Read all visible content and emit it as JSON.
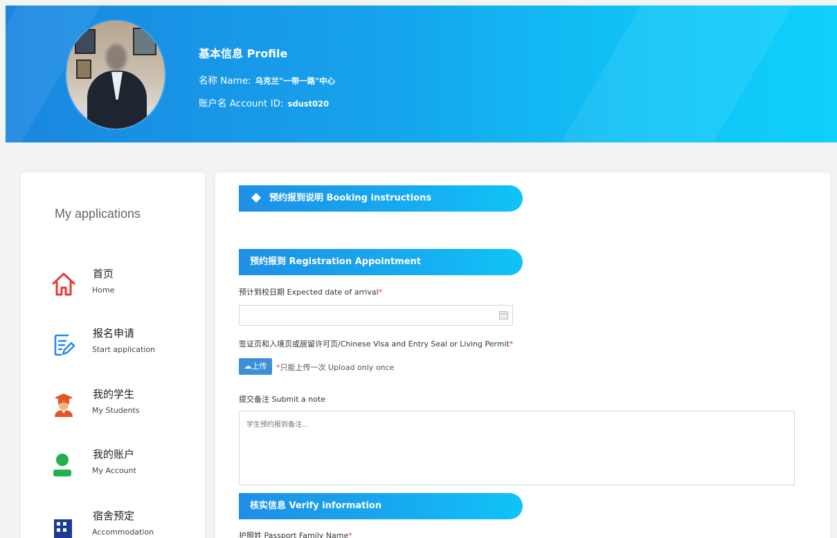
{
  "profile": {
    "title": "基本信息 Profile",
    "name_label": "名称 Name:",
    "name_value": "乌克兰\"一带一路\"中心",
    "account_label": "账户名 Account ID:",
    "account_value": "sdust020"
  },
  "sidebar": {
    "title": "My applications",
    "items": [
      {
        "cn": "首页",
        "en": "Home",
        "icon": "home-icon"
      },
      {
        "cn": "报名申请",
        "en": "Start application",
        "icon": "edit-document-icon"
      },
      {
        "cn": "我的学生",
        "en": "My Students",
        "icon": "graduate-student-icon"
      },
      {
        "cn": "我的账户",
        "en": "My Account",
        "icon": "user-account-icon"
      },
      {
        "cn": "宿舍预定",
        "en": "Accommodation",
        "icon": "building-icon"
      }
    ]
  },
  "main": {
    "booking_instructions": "预约报到说明 Booking instructions",
    "registration_title": "预约报到 Registration Appointment",
    "arrival_label": "预计到校日期 Expected date of arrival",
    "arrival_value": "",
    "visa_label": "签证页和入境页或居留许可页/Chinese Visa and Entry Seal or Living Permit",
    "upload_button": "上传",
    "upload_note": "只能上传一次 Upload only once",
    "note_label": "提交备注 Submit a note",
    "note_placeholder": "学生预约报到备注...",
    "verify_title": "核实信息 Verify information",
    "family_name_label": "护照姓 Passport Family Name",
    "required_mark": "*"
  },
  "colors": {
    "banner_start": "#1a86e0",
    "banner_end": "#0fd0fb",
    "icon_red": "#e53935",
    "icon_blue": "#1e88e5",
    "icon_green": "#22b14c",
    "button_blue": "#3d90d8"
  }
}
